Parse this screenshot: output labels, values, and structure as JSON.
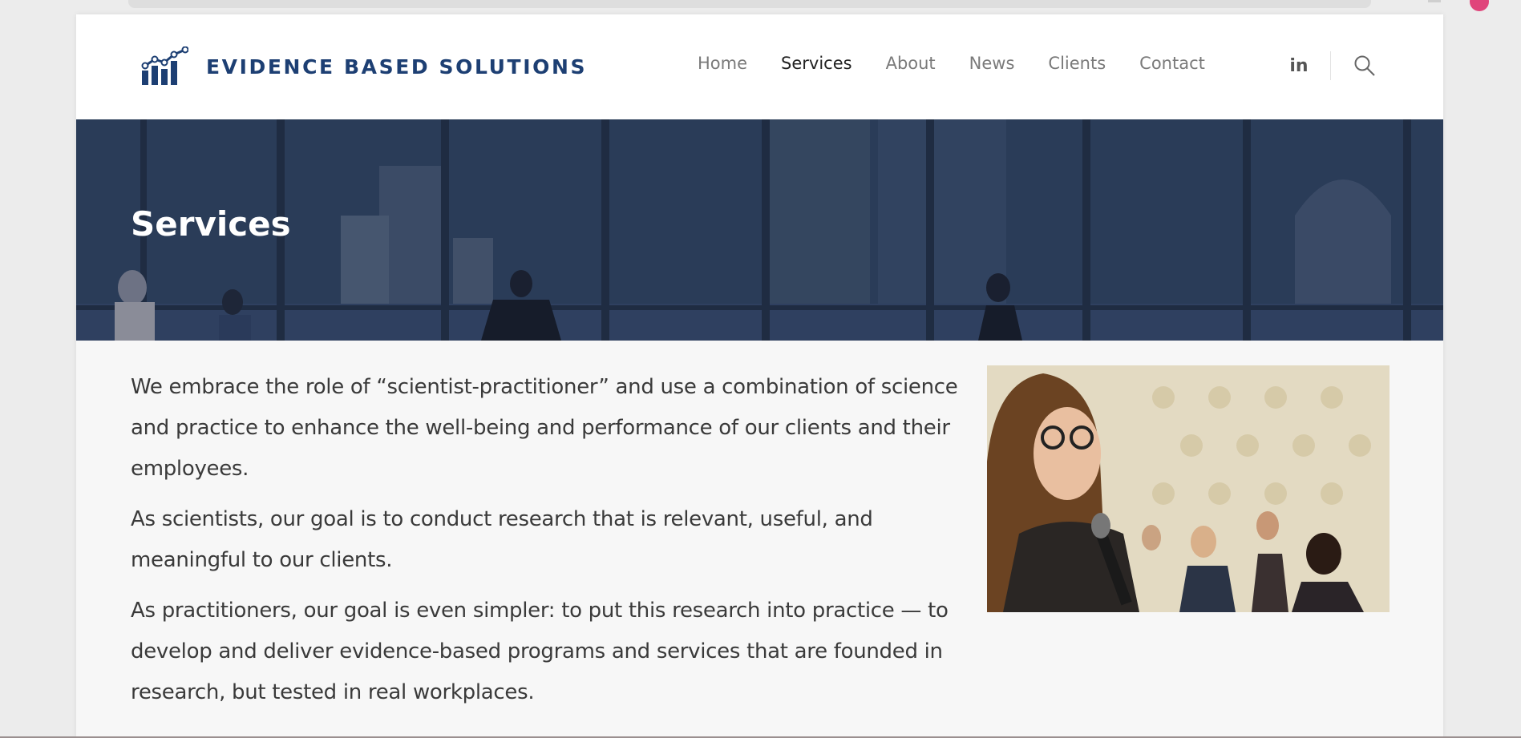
{
  "brand": {
    "name": "EVIDENCE BASED SOLUTIONS",
    "logo_icon": "bar-chart-trend-icon",
    "color": "#1d3f73"
  },
  "nav": {
    "items": [
      {
        "label": "Home",
        "active": false
      },
      {
        "label": "Services",
        "active": true
      },
      {
        "label": "About",
        "active": false
      },
      {
        "label": "News",
        "active": false
      },
      {
        "label": "Clients",
        "active": false
      },
      {
        "label": "Contact",
        "active": false
      }
    ],
    "social_icon": "linkedin-icon",
    "social_label": "in",
    "search_icon": "search-icon"
  },
  "hero": {
    "title": "Services",
    "overlay_color": "#283a57"
  },
  "content": {
    "paragraphs": [
      "We embrace the role of “scientist-practitioner” and use a combination of science and practice to enhance the well-being and performance of our clients and their employees.",
      "As scientists, our goal is to conduct research that is relevant, useful, and meaningful to our clients.",
      "As practitioners, our goal is even simpler: to put this research into practice — to develop and deliver evidence-based programs and services that are founded in research, but tested in real workplaces."
    ]
  }
}
